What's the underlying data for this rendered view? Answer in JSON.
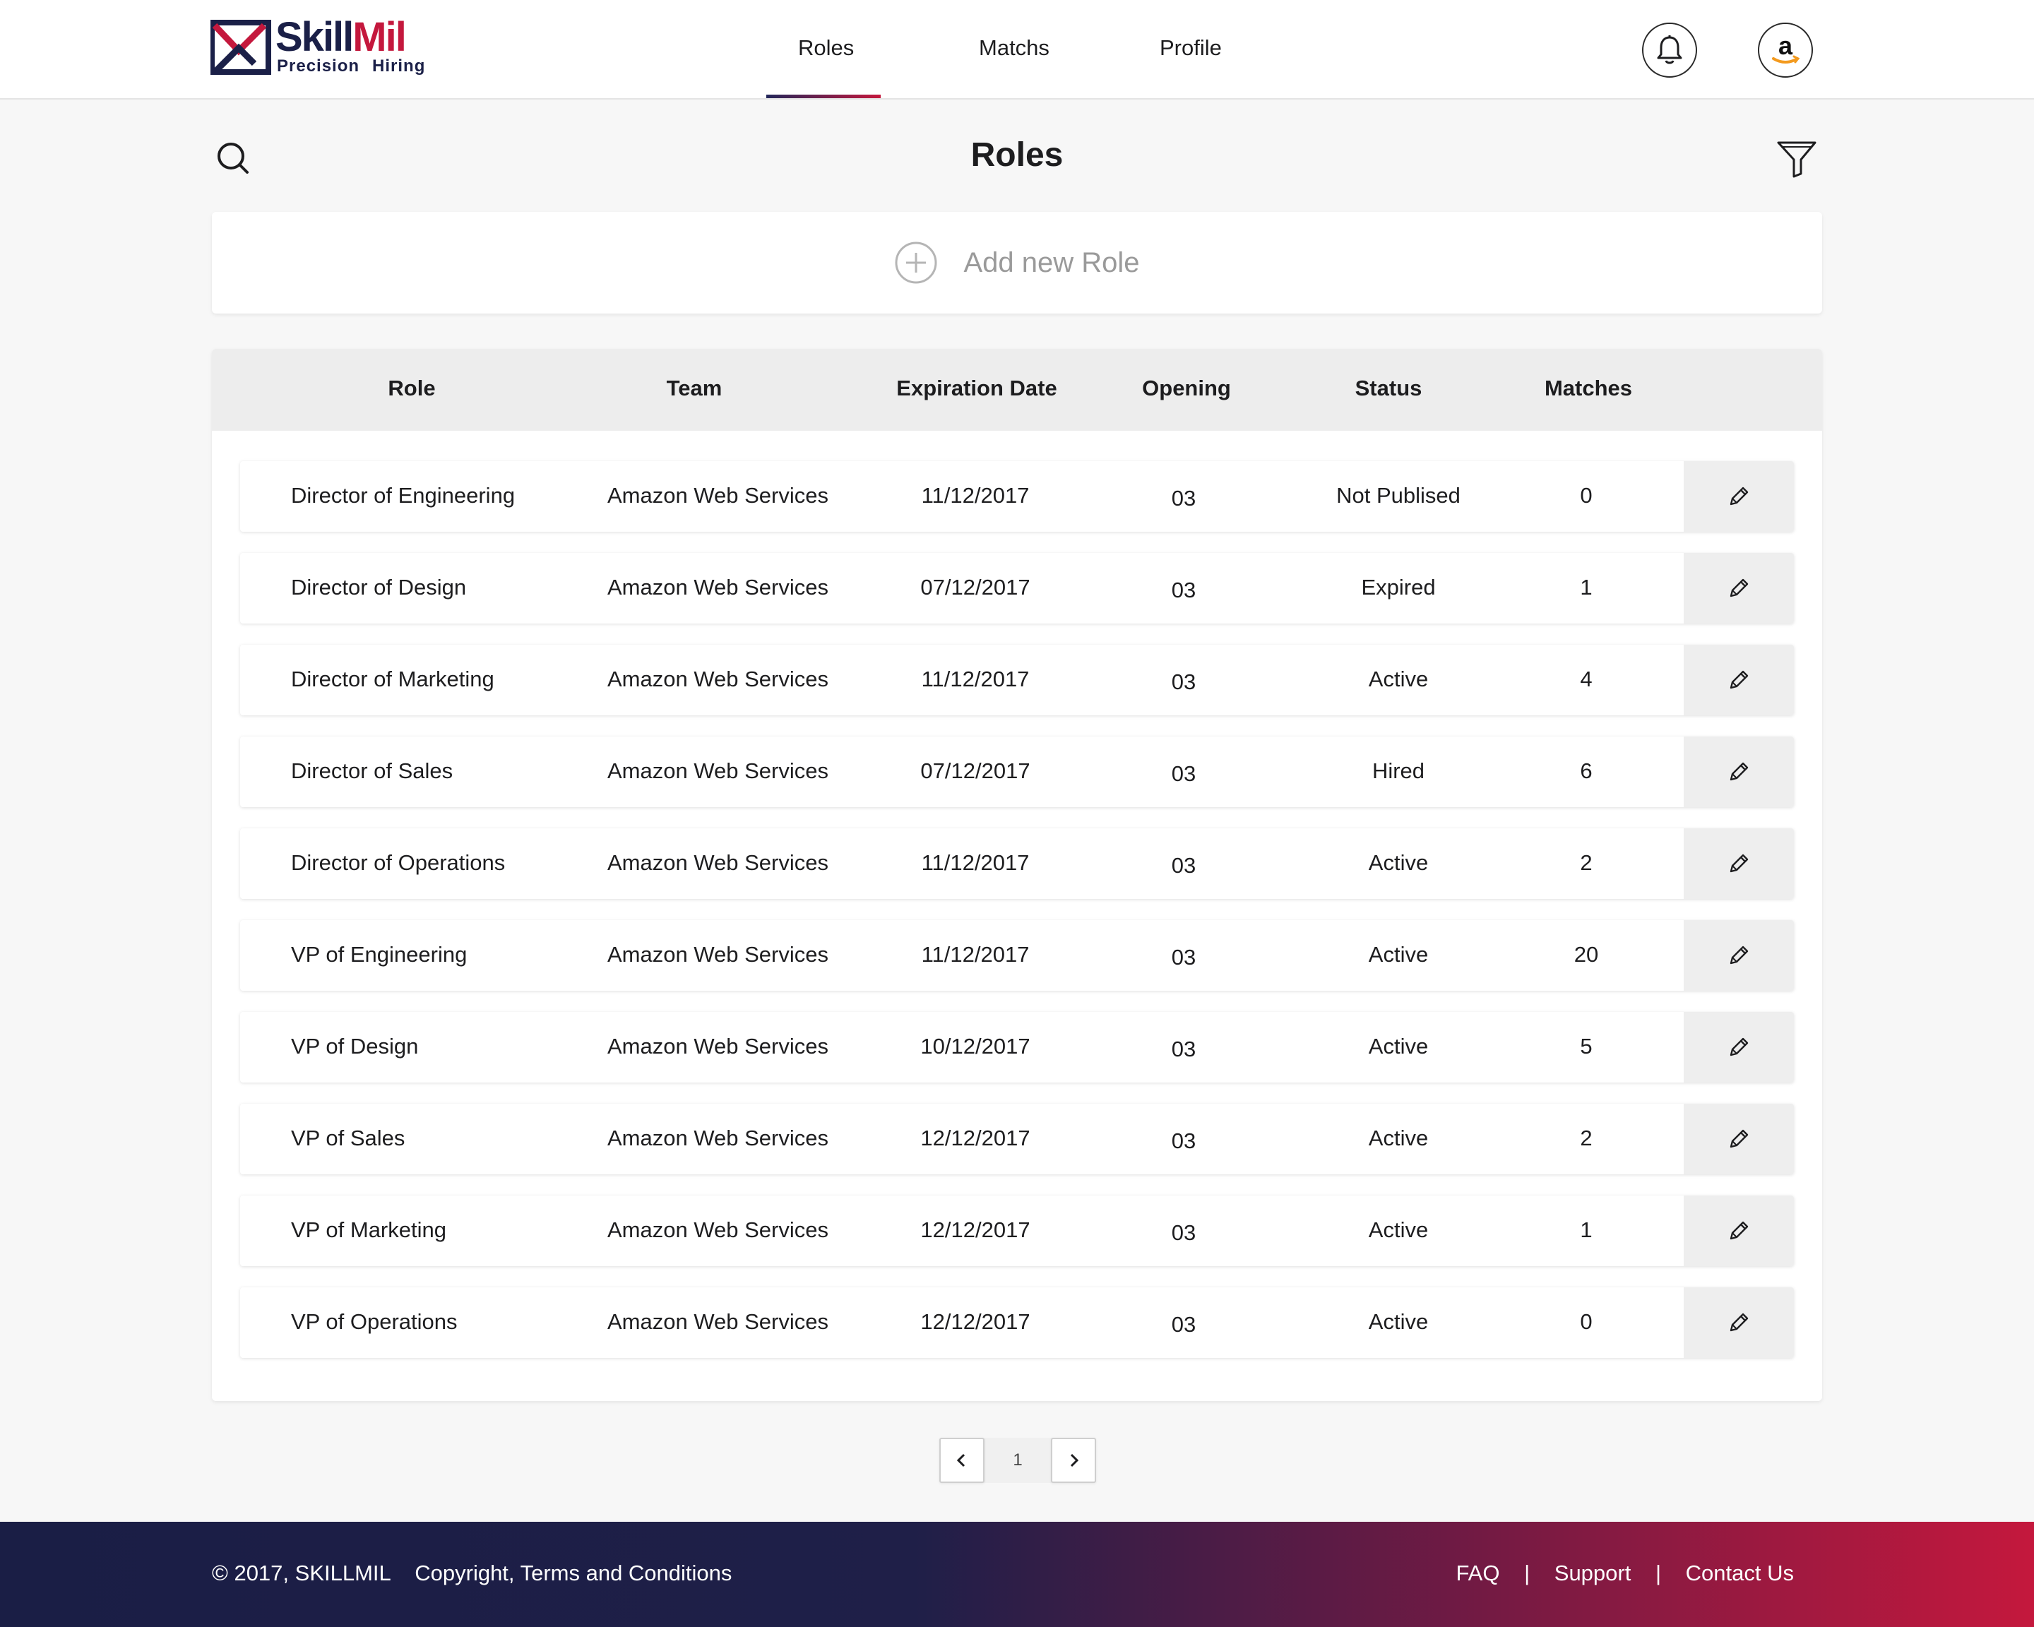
{
  "brand": {
    "word_dark": "Skill",
    "word_accent": "Mil",
    "tag_1": "Precision",
    "tag_2": "Hiring",
    "dark_color": "#1b2048",
    "accent_color": "#c4183d"
  },
  "nav": {
    "items": [
      {
        "label": "Roles",
        "active": true
      },
      {
        "label": "Matchs",
        "active": false
      },
      {
        "label": "Profile",
        "active": false
      }
    ],
    "notifications_icon": "bell-icon",
    "avatar_icon": "amazon-logo-avatar"
  },
  "page": {
    "title": "Roles",
    "search_icon": "search-icon",
    "filter_icon": "filter-icon"
  },
  "add_role": {
    "label": "Add new Role",
    "icon": "plus-circle-icon"
  },
  "table": {
    "headers": {
      "role": "Role",
      "team": "Team",
      "expiration": "Expiration Date",
      "opening": "Opening",
      "status": "Status",
      "matches": "Matches"
    },
    "rows": [
      {
        "role": "Director of Engineering",
        "team": "Amazon Web Services",
        "expiration": "11/12/2017",
        "opening": "03",
        "status": "Not Publised",
        "matches": "0"
      },
      {
        "role": "Director of Design",
        "team": "Amazon Web Services",
        "expiration": "07/12/2017",
        "opening": "03",
        "status": "Expired",
        "matches": "1"
      },
      {
        "role": "Director of Marketing",
        "team": "Amazon Web Services",
        "expiration": "11/12/2017",
        "opening": "03",
        "status": "Active",
        "matches": "4"
      },
      {
        "role": "Director of Sales",
        "team": "Amazon Web Services",
        "expiration": "07/12/2017",
        "opening": "03",
        "status": "Hired",
        "matches": "6"
      },
      {
        "role": "Director of Operations",
        "team": "Amazon Web Services",
        "expiration": "11/12/2017",
        "opening": "03",
        "status": "Active",
        "matches": "2"
      },
      {
        "role": "VP of Engineering",
        "team": "Amazon Web Services",
        "expiration": "11/12/2017",
        "opening": "03",
        "status": "Active",
        "matches": "20"
      },
      {
        "role": "VP of Design",
        "team": "Amazon Web Services",
        "expiration": "10/12/2017",
        "opening": "03",
        "status": "Active",
        "matches": "5"
      },
      {
        "role": "VP of Sales",
        "team": "Amazon Web Services",
        "expiration": "12/12/2017",
        "opening": "03",
        "status": "Active",
        "matches": "2"
      },
      {
        "role": "VP of Marketing",
        "team": "Amazon Web Services",
        "expiration": "12/12/2017",
        "opening": "03",
        "status": "Active",
        "matches": "1"
      },
      {
        "role": "VP of Operations",
        "team": "Amazon Web Services",
        "expiration": "12/12/2017",
        "opening": "03",
        "status": "Active",
        "matches": "0"
      }
    ],
    "edit_icon": "pencil-icon"
  },
  "pagination": {
    "current": "1",
    "prev_icon": "chevron-left-icon",
    "next_icon": "chevron-right-icon"
  },
  "footer": {
    "copyright": "© 2017, SKILLMIL",
    "terms": "Copyright, Terms and Conditions",
    "links": [
      "FAQ",
      "Support",
      "Contact Us"
    ],
    "separator": "|"
  }
}
